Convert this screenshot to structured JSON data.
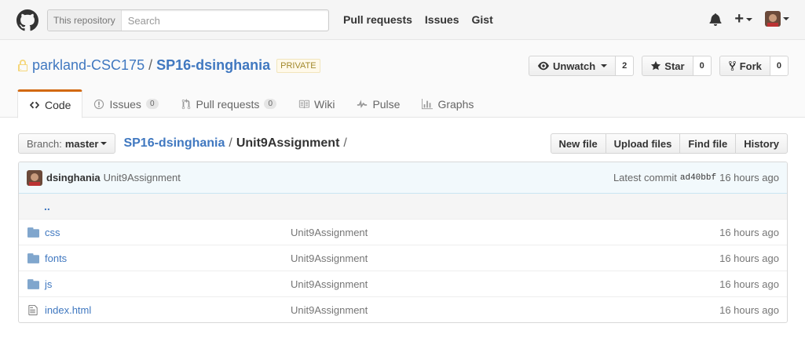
{
  "header": {
    "search_scope": "This repository",
    "search_placeholder": "Search",
    "nav": [
      "Pull requests",
      "Issues",
      "Gist"
    ],
    "plus_label": "+"
  },
  "repo": {
    "owner": "parkland-CSC175",
    "separator": "/",
    "name": "SP16-dsinghania",
    "visibility": "PRIVATE",
    "watch": {
      "label": "Unwatch",
      "count": "2"
    },
    "star": {
      "label": "Star",
      "count": "0"
    },
    "fork": {
      "label": "Fork",
      "count": "0"
    }
  },
  "tabs": [
    {
      "label": "Code",
      "icon": "code-icon",
      "selected": true
    },
    {
      "label": "Issues",
      "icon": "issue-icon",
      "badge": "0"
    },
    {
      "label": "Pull requests",
      "icon": "pull-request-icon",
      "badge": "0"
    },
    {
      "label": "Wiki",
      "icon": "book-icon"
    },
    {
      "label": "Pulse",
      "icon": "pulse-icon"
    },
    {
      "label": "Graphs",
      "icon": "graph-icon"
    }
  ],
  "filenav": {
    "branch_label": "Branch:",
    "branch": "master",
    "crumb_repo": "SP16-dsinghania",
    "crumb_sep": "/",
    "crumb_current": "Unit9Assignment",
    "crumb_trailing": "/",
    "buttons": [
      "New file",
      "Upload files",
      "Find file",
      "History"
    ]
  },
  "commit": {
    "author": "dsinghania",
    "message": "Unit9Assignment",
    "latest_label": "Latest commit",
    "sha": "ad40bbf",
    "age": "16 hours ago"
  },
  "files": {
    "up": "..",
    "rows": [
      {
        "name": "css",
        "type": "folder",
        "message": "Unit9Assignment",
        "age": "16 hours ago"
      },
      {
        "name": "fonts",
        "type": "folder",
        "message": "Unit9Assignment",
        "age": "16 hours ago"
      },
      {
        "name": "js",
        "type": "folder",
        "message": "Unit9Assignment",
        "age": "16 hours ago"
      },
      {
        "name": "index.html",
        "type": "file",
        "message": "Unit9Assignment",
        "age": "16 hours ago"
      }
    ]
  },
  "colors": {
    "link": "#4078c0",
    "tab_accent": "#d26911",
    "folder": "#80a6cd"
  }
}
